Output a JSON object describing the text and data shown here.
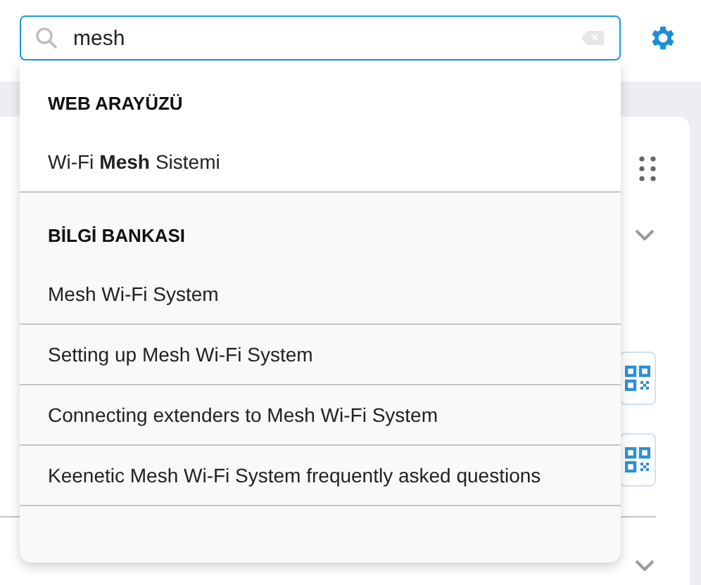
{
  "search": {
    "value": "mesh"
  },
  "results": [
    {
      "heading": "WEB ARAYÜZÜ",
      "items": [
        {
          "text": "Wi-Fi **Mesh** Sistemi"
        }
      ]
    },
    {
      "heading": "BİLGİ BANKASI",
      "items": [
        {
          "text": "Mesh Wi-Fi System"
        },
        {
          "text": "Setting up Mesh Wi-Fi System"
        },
        {
          "text": "Connecting extenders to Mesh Wi-Fi System"
        },
        {
          "text": "Keenetic Mesh Wi-Fi System frequently asked questions"
        }
      ]
    }
  ]
}
